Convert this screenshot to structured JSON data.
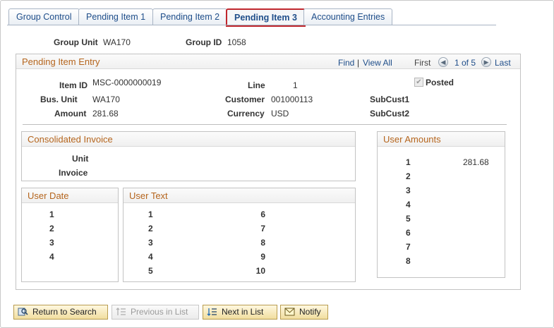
{
  "tabs": [
    {
      "label": "Group Control"
    },
    {
      "label": "Pending Item 1"
    },
    {
      "label": "Pending Item 2"
    },
    {
      "label": "Pending Item 3"
    },
    {
      "label": "Accounting Entries"
    }
  ],
  "header": {
    "group_unit_label": "Group Unit",
    "group_unit_value": "WA170",
    "group_id_label": "Group ID",
    "group_id_value": "1058"
  },
  "entry": {
    "title": "Pending Item Entry",
    "find": "Find",
    "pipe": "|",
    "view_all": "View All",
    "first": "First",
    "counter": "1 of 5",
    "last": "Last",
    "item_id_label": "Item ID",
    "item_id_value": "MSC-0000000019",
    "line_label": "Line",
    "line_value": "1",
    "posted_label": "Posted",
    "bus_unit_label": "Bus. Unit",
    "bus_unit_value": "WA170",
    "customer_label": "Customer",
    "customer_value": "001000113",
    "subcust1_label": "SubCust1",
    "amount_label": "Amount",
    "amount_value": "281.68",
    "currency_label": "Currency",
    "currency_value": "USD",
    "subcust2_label": "SubCust2"
  },
  "consolidated": {
    "title": "Consolidated Invoice",
    "unit_label": "Unit",
    "invoice_label": "Invoice"
  },
  "user_amounts": {
    "title": "User Amounts",
    "rows": [
      "1",
      "2",
      "3",
      "4",
      "5",
      "6",
      "7",
      "8"
    ],
    "value_1": "281.68"
  },
  "user_date": {
    "title": "User Date",
    "rows": [
      "1",
      "2",
      "3",
      "4"
    ]
  },
  "user_text": {
    "title": "User Text",
    "left_rows": [
      "1",
      "2",
      "3",
      "4",
      "5"
    ],
    "right_rows": [
      "6",
      "7",
      "8",
      "9",
      "10"
    ]
  },
  "buttons": {
    "return": "Return to Search",
    "previous": "Previous in List",
    "next": "Next in List",
    "notify": "Notify"
  },
  "colors": {
    "accent_link": "#1f4e8a",
    "section_title": "#b5651d",
    "active_tab_border": "#c0272d"
  }
}
